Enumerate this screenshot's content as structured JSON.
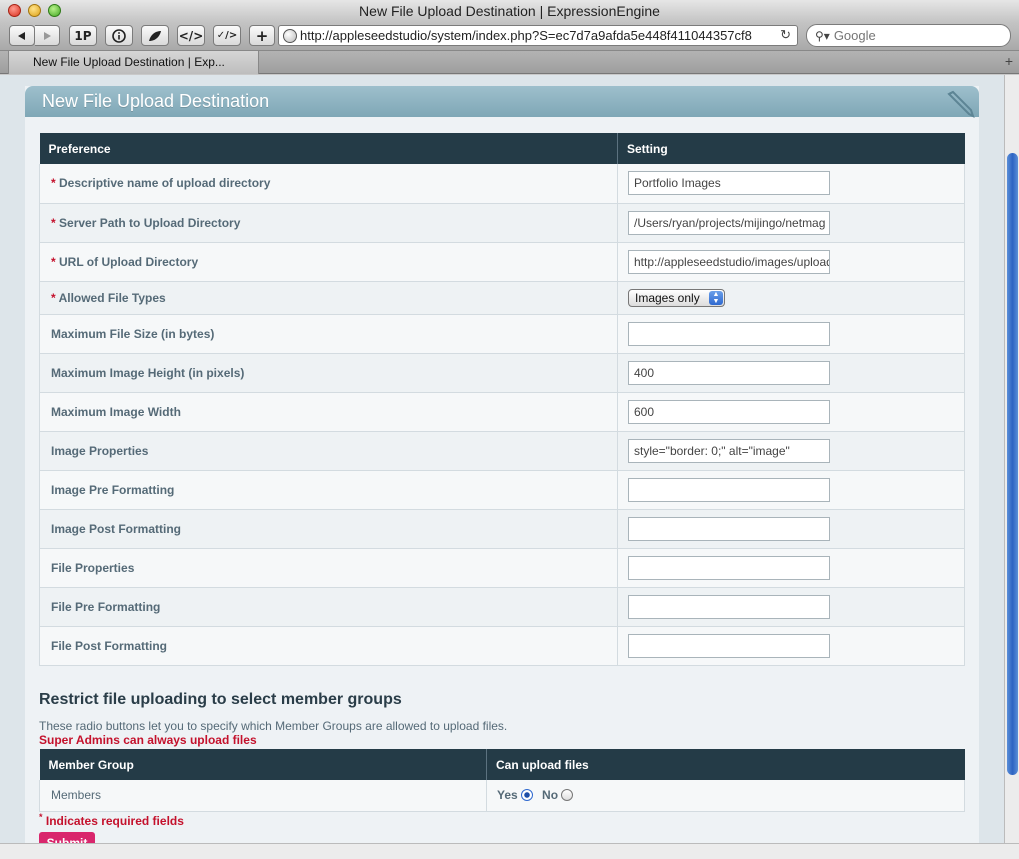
{
  "window": {
    "title": "New File Upload Destination | ExpressionEngine"
  },
  "toolbar": {
    "back_icon": "back-arrow-icon",
    "forward_icon": "forward-arrow-icon",
    "onepassword_label": "1P",
    "info_label": "i",
    "leaf_icon": "leaf-icon",
    "source_label": "</>",
    "validate_label": "✓/>",
    "add_label": "+",
    "url": "http://appleseedstudio/system/index.php?S=ec7d7a9afda5e448f411044357cf8",
    "search_placeholder": "Google"
  },
  "tabs": [
    {
      "label": "New File Upload Destination | Exp..."
    }
  ],
  "panel": {
    "title": "New File Upload Destination"
  },
  "prefs_table": {
    "headers": [
      "Preference",
      "Setting"
    ],
    "rows": [
      {
        "label": "Descriptive name of upload directory",
        "required": true,
        "type": "text",
        "value": "Portfolio Images"
      },
      {
        "label": "Server Path to Upload Directory",
        "required": true,
        "type": "text",
        "value": "/Users/ryan/projects/mijingo/netmag"
      },
      {
        "label": "URL of Upload Directory",
        "required": true,
        "type": "text",
        "value": "http://appleseedstudio/images/uploads/"
      },
      {
        "label": "Allowed File Types",
        "required": true,
        "type": "select",
        "value": "Images only"
      },
      {
        "label": "Maximum File Size (in bytes)",
        "required": false,
        "type": "text",
        "value": ""
      },
      {
        "label": "Maximum Image Height (in pixels)",
        "required": false,
        "type": "text",
        "value": "400"
      },
      {
        "label": "Maximum Image Width",
        "required": false,
        "type": "text",
        "value": "600"
      },
      {
        "label": "Image Properties",
        "required": false,
        "type": "text",
        "value": "style=\"border: 0;\" alt=\"image\""
      },
      {
        "label": "Image Pre Formatting",
        "required": false,
        "type": "text",
        "value": ""
      },
      {
        "label": "Image Post Formatting",
        "required": false,
        "type": "text",
        "value": ""
      },
      {
        "label": "File Properties",
        "required": false,
        "type": "text",
        "value": ""
      },
      {
        "label": "File Pre Formatting",
        "required": false,
        "type": "text",
        "value": ""
      },
      {
        "label": "File Post Formatting",
        "required": false,
        "type": "text",
        "value": ""
      }
    ]
  },
  "member_section": {
    "title": "Restrict file uploading to select member groups",
    "description": "These radio buttons let you to specify which Member Groups are allowed to upload files.",
    "warning": "Super Admins can always upload files",
    "headers": [
      "Member Group",
      "Can upload files"
    ],
    "rows": [
      {
        "group": "Members",
        "yes_label": "Yes",
        "no_label": "No",
        "selected": "Yes"
      }
    ]
  },
  "footer": {
    "required_note": "Indicates required fields",
    "required_marker": "*",
    "submit_label": "Submit"
  },
  "colors": {
    "header_dark": "#243b47",
    "required_red": "#c4112c",
    "submit_pink": "#d9266c",
    "panel_head": "#8fb4c2"
  }
}
